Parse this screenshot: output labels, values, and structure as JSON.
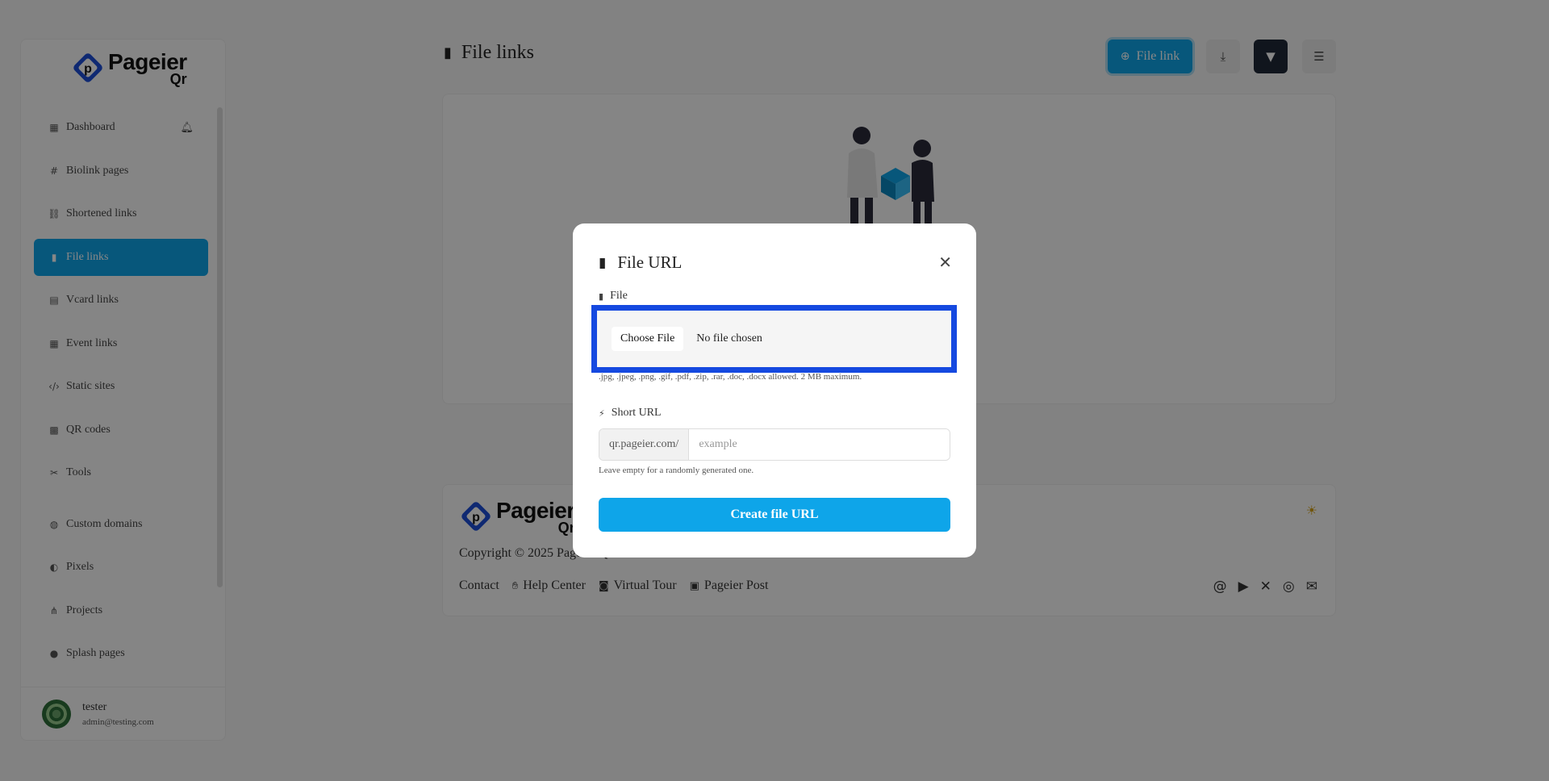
{
  "brand": {
    "name_line1": "Pageier",
    "name_line2": "Qr",
    "accent": "#0ea5e9",
    "mark_color": "#1d4ed8"
  },
  "sidebar": {
    "items": [
      {
        "label": "Dashboard",
        "icon": "table-icon"
      },
      {
        "label": "Biolink pages",
        "icon": "hash-icon"
      },
      {
        "label": "Shortened links",
        "icon": "link-icon"
      },
      {
        "label": "File links",
        "icon": "file-icon",
        "active": true
      },
      {
        "label": "Vcard links",
        "icon": "id-card-icon"
      },
      {
        "label": "Event links",
        "icon": "calendar-icon"
      },
      {
        "label": "Static sites",
        "icon": "code-icon"
      },
      {
        "label": "QR codes",
        "icon": "qrcode-icon"
      },
      {
        "label": "Tools",
        "icon": "tools-icon"
      },
      {
        "label": "Custom domains",
        "icon": "globe-icon"
      },
      {
        "label": "Pixels",
        "icon": "adjust-icon"
      },
      {
        "label": "Projects",
        "icon": "project-diagram-icon"
      },
      {
        "label": "Splash pages",
        "icon": "droplet-icon"
      }
    ]
  },
  "user": {
    "name": "tester",
    "email": "admin@testing.com"
  },
  "header": {
    "title": "File links",
    "create_label": "File link"
  },
  "footer": {
    "copyright": "Copyright © 2025 Pageier Qr.",
    "links": [
      {
        "label": "Contact",
        "icon": ""
      },
      {
        "label": "Help Center",
        "icon": "hands-icon"
      },
      {
        "label": "Virtual Tour",
        "icon": "vr-cardboard-icon"
      },
      {
        "label": "Pageier Post",
        "icon": "newspaper-icon"
      }
    ],
    "social": [
      "threads-icon",
      "youtube-icon",
      "x-icon",
      "instagram-icon",
      "envelope-icon"
    ]
  },
  "modal": {
    "title": "File URL",
    "file_label": "File",
    "choose_file": "Choose File",
    "no_file": "No file chosen",
    "file_help": ".jpg, .jpeg, .png, .gif, .pdf, .zip, .rar, .doc, .docx allowed. 2 MB maximum.",
    "short_url_label": "Short URL",
    "url_prefix": "qr.pageier.com/",
    "url_placeholder": "example",
    "url_help": "Leave empty for a randomly generated one.",
    "submit_label": "Create file URL"
  }
}
